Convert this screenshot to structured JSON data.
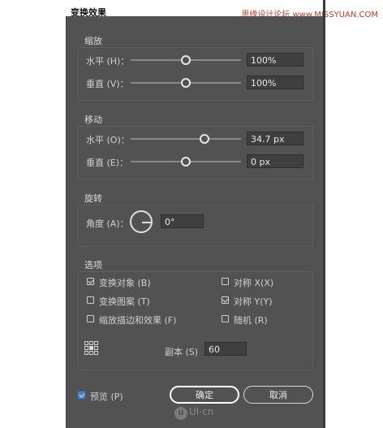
{
  "window": {
    "title": "变换效果"
  },
  "watermark": "思缘设计论坛  www.MISSYUAN.COM",
  "scale": {
    "title": "缩放",
    "horizontal": {
      "label": "水平 (H)：",
      "value": "100%",
      "level": 0.5
    },
    "vertical": {
      "label": "垂直 (V)：",
      "value": "100%",
      "level": 0.5
    }
  },
  "move": {
    "title": "移动",
    "horizontal": {
      "label": "水平 (O)：",
      "value": "34.7 px",
      "level": 0.63
    },
    "vertical": {
      "label": "垂直 (E)：",
      "value": "0 px",
      "level": 0.5
    }
  },
  "rotate": {
    "title": "旋转",
    "angle_label": "角度 (A)：",
    "angle_value": "0°"
  },
  "options": {
    "title": "选项",
    "transform_objects": {
      "label": "变换对象 (B)",
      "checked": true
    },
    "transform_patterns": {
      "label": "变换图案 (T)",
      "checked": false
    },
    "scale_strokes": {
      "label": "缩放描边和效果 (F)",
      "checked": false
    },
    "reflect_x": {
      "label": "对称 X(X)",
      "checked": false
    },
    "reflect_y": {
      "label": "对称 Y(Y)",
      "checked": true
    },
    "random": {
      "label": "随机 (R)",
      "checked": false
    },
    "copies_label": "副本 (S)",
    "copies_value": "60"
  },
  "footer": {
    "preview_label": "预览 (P)",
    "preview_checked": true,
    "ok_label": "确定",
    "cancel_label": "取消"
  },
  "logo_text": "UI·cn"
}
